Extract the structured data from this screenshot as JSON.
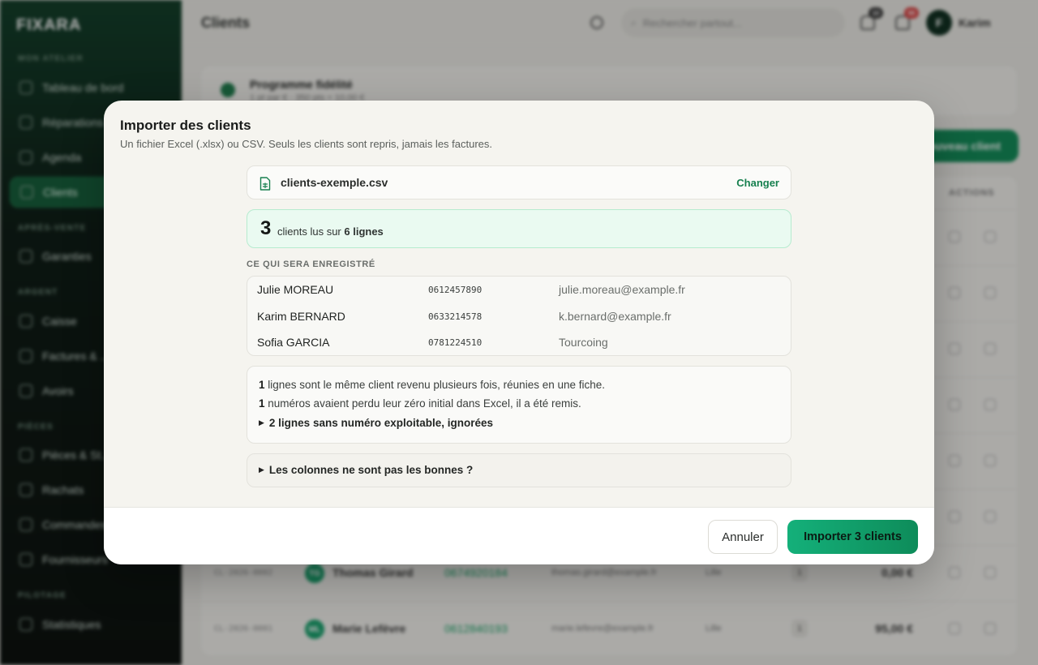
{
  "background": {
    "brand": "FIXARA",
    "sidebar": {
      "sections": [
        {
          "label": "MON ATELIER",
          "items": [
            {
              "label": "Tableau de bord",
              "icon": "home-icon"
            },
            {
              "label": "Réparations",
              "icon": "wrench-icon"
            },
            {
              "label": "Agenda",
              "icon": "calendar-icon"
            },
            {
              "label": "Clients",
              "icon": "users-icon",
              "active": true
            }
          ]
        },
        {
          "label": "APRÈS-VENTE",
          "items": [
            {
              "label": "Garanties",
              "icon": "shield-icon"
            }
          ]
        },
        {
          "label": "ARGENT",
          "items": [
            {
              "label": "Caisse",
              "icon": "register-icon"
            },
            {
              "label": "Factures & ...",
              "icon": "invoice-icon"
            },
            {
              "label": "Avoirs",
              "icon": "undo-icon"
            }
          ]
        },
        {
          "label": "PIÈCES",
          "items": [
            {
              "label": "Pièces & St...",
              "icon": "box-icon"
            },
            {
              "label": "Rachats",
              "icon": "repeat-icon"
            },
            {
              "label": "Commandes",
              "icon": "cart-icon"
            },
            {
              "label": "Fournisseurs",
              "icon": "truck-icon"
            }
          ]
        },
        {
          "label": "PILOTAGE",
          "items": [
            {
              "label": "Statistiques",
              "icon": "chart-icon"
            }
          ]
        }
      ]
    },
    "topbar": {
      "title": "Clients",
      "search_placeholder": "Rechercher partout...",
      "badge_inbox": "10",
      "badge_notifications": "99",
      "user_initial": "F",
      "user_name": "Karim"
    },
    "loyalty": {
      "title": "Programme fidélité",
      "subtitle": "1 pt par € · 350 pts = 10,00 €"
    },
    "new_client_label": "Nouveau client",
    "table": {
      "actions_header": "ACTIONS",
      "rows": [
        {
          "ref": "CL-2026-0002",
          "initials": "TG",
          "name": "Thomas Girard",
          "phone": "0674920184",
          "email": "thomas.girard@example.fr",
          "city": "Lille",
          "count": "1",
          "amount": "0,00 €"
        },
        {
          "ref": "CL-2026-0001",
          "initials": "ML",
          "name": "Marie Lefèvre",
          "phone": "0612840193",
          "email": "marie.lefevre@example.fr",
          "city": "Lille",
          "count": "1",
          "amount": "95,00 €"
        }
      ]
    }
  },
  "modal": {
    "title": "Importer des clients",
    "subtitle": "Un fichier Excel (.xlsx) ou CSV. Seuls les clients sont repris, jamais les factures.",
    "file": {
      "name": "clients-exemple.csv",
      "change_label": "Changer"
    },
    "summary": {
      "count": "3",
      "text_prefix": "clients lus sur",
      "lines": "6 lignes"
    },
    "preview_label": "CE QUI SERA ENREGISTRÉ",
    "preview_rows": [
      {
        "name": "Julie MOREAU",
        "phone": "0612457890",
        "extra": "julie.moreau@example.fr"
      },
      {
        "name": "Karim BERNARD",
        "phone": "0633214578",
        "extra": "k.bernard@example.fr"
      },
      {
        "name": "Sofia GARCIA",
        "phone": "0781224510",
        "extra": "Tourcoing"
      }
    ],
    "notes": {
      "duplicates_count": "1",
      "duplicates_text": "lignes sont le même client revenu plusieurs fois, réunies en une fiche.",
      "zero_count": "1",
      "zero_text": "numéros avaient perdu leur zéro initial dans Excel, il a été remis.",
      "ignored_toggle": "2 lignes sans numéro exploitable, ignorées"
    },
    "columns_toggle": "Les colonnes ne sont pas les bonnes ?",
    "cancel_label": "Annuler",
    "import_label": "Importer 3 clients"
  },
  "colors": {
    "accent": "#0e8c5a",
    "accent_light": "#eafaf1",
    "link": "#17804f"
  }
}
